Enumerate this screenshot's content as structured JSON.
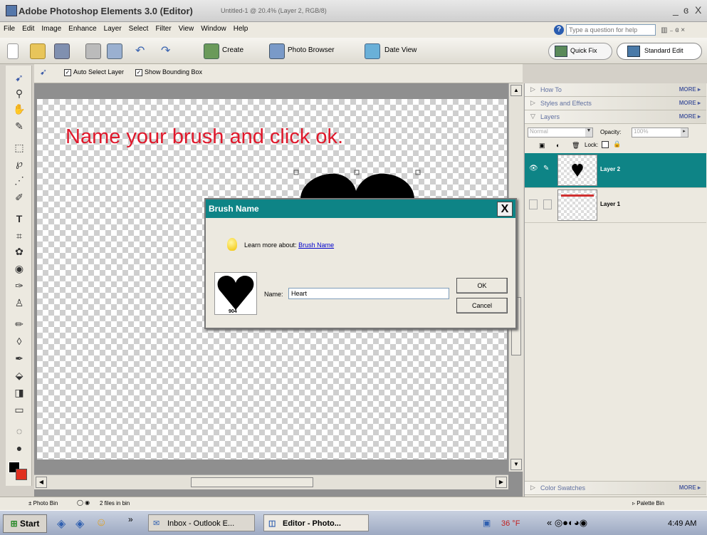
{
  "window": {
    "app_title": "Adobe Photoshop Elements 3.0 (Editor)",
    "doc_title": "Untitled-1 @ 20.4% (Layer 2, RGB/8)",
    "controls": [
      "_",
      "ɞ",
      "X"
    ]
  },
  "menubar": {
    "items": [
      "File",
      "Edit",
      "Image",
      "Enhance",
      "Layer",
      "Select",
      "Filter",
      "View",
      "Window",
      "Help"
    ],
    "help_placeholder": "Type a question for help"
  },
  "toolbar": {
    "create": "Create",
    "photo_browser": "Photo Browser",
    "date_view": "Date View",
    "quick_fix": "Quick Fix",
    "standard_edit": "Standard Edit"
  },
  "options": {
    "auto_select": "Auto Select Layer",
    "bounding_box": "Show Bounding Box",
    "auto_select_checked": true,
    "bounding_box_checked": true
  },
  "canvas": {
    "instruction": "Name your brush and click ok."
  },
  "palette": {
    "how_to": "How To",
    "styles": "Styles and Effects",
    "layers": "Layers",
    "more": "MORE",
    "blend_mode": "Normal",
    "opacity_label": "Opacity:",
    "opacity_value": "100%",
    "lock_label": "Lock:",
    "layer_items": [
      "Layer 2",
      "Layer 1"
    ],
    "color_swatches": "Color Swatches",
    "palette_bin": "Palette Bin"
  },
  "dialog": {
    "title": "Brush Name",
    "close": "X",
    "learn_prefix": "Learn more about:",
    "learn_link": "Brush Name",
    "brush_size": "904",
    "name_label": "Name:",
    "name_value": "Heart",
    "ok": "OK",
    "cancel": "Cancel"
  },
  "statusbar": {
    "photo_bin": "Photo Bin",
    "files": "2 files in bin",
    "palette_bin": "Palette Bin"
  },
  "taskbar": {
    "start": "Start",
    "task1": "Inbox - Outlook E...",
    "task2": "Editor - Photo...",
    "temp": "36 °F",
    "clock": "4:49 AM"
  },
  "colors": {
    "dialog_title_bg": "#0e8486",
    "instruction_text": "#e0182b",
    "selected_layer_bg": "#0e8486",
    "foreground_swatch": "#000000",
    "background_swatch": "#e03020"
  }
}
